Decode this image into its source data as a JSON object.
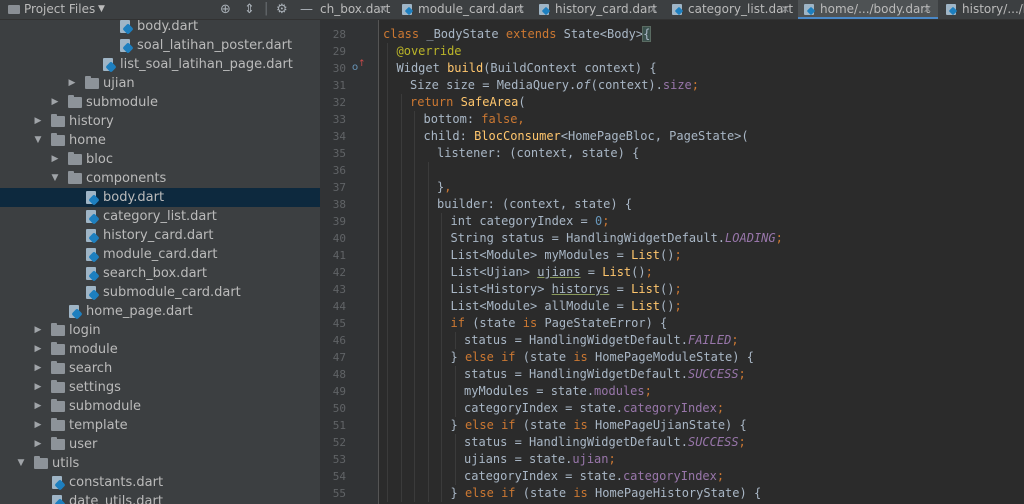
{
  "project_panel": {
    "title": "Project Files",
    "toolbar_icons": [
      "crosshair-icon",
      "collapse-icon",
      "gear-icon",
      "minimize-icon"
    ],
    "tree": [
      {
        "label": "body.dart",
        "type": "file",
        "depth": 7
      },
      {
        "label": "soal_latihan_poster.dart",
        "type": "file",
        "depth": 7
      },
      {
        "label": "list_soal_latihan_page.dart",
        "type": "file",
        "depth": 6
      },
      {
        "label": "ujian",
        "type": "folder",
        "depth": 5,
        "expanded": false
      },
      {
        "label": "submodule",
        "type": "folder",
        "depth": 4,
        "expanded": false
      },
      {
        "label": "history",
        "type": "folder",
        "depth": 3,
        "expanded": false
      },
      {
        "label": "home",
        "type": "folder",
        "depth": 3,
        "expanded": true
      },
      {
        "label": "bloc",
        "type": "folder",
        "depth": 4,
        "expanded": false
      },
      {
        "label": "components",
        "type": "folder",
        "depth": 4,
        "expanded": true
      },
      {
        "label": "body.dart",
        "type": "file",
        "depth": 5,
        "selected": true
      },
      {
        "label": "category_list.dart",
        "type": "file",
        "depth": 5
      },
      {
        "label": "history_card.dart",
        "type": "file",
        "depth": 5
      },
      {
        "label": "module_card.dart",
        "type": "file",
        "depth": 5
      },
      {
        "label": "search_box.dart",
        "type": "file",
        "depth": 5
      },
      {
        "label": "submodule_card.dart",
        "type": "file",
        "depth": 5
      },
      {
        "label": "home_page.dart",
        "type": "file",
        "depth": 4
      },
      {
        "label": "login",
        "type": "folder",
        "depth": 3,
        "expanded": false
      },
      {
        "label": "module",
        "type": "folder",
        "depth": 3,
        "expanded": false
      },
      {
        "label": "search",
        "type": "folder",
        "depth": 3,
        "expanded": false
      },
      {
        "label": "settings",
        "type": "folder",
        "depth": 3,
        "expanded": false
      },
      {
        "label": "submodule",
        "type": "folder",
        "depth": 3,
        "expanded": false
      },
      {
        "label": "template",
        "type": "folder",
        "depth": 3,
        "expanded": false
      },
      {
        "label": "user",
        "type": "folder",
        "depth": 3,
        "expanded": false
      },
      {
        "label": "utils",
        "type": "folder",
        "depth": 2,
        "expanded": true
      },
      {
        "label": "constants.dart",
        "type": "file",
        "depth": 3
      },
      {
        "label": "date_utils.dart",
        "type": "file",
        "depth": 3
      }
    ]
  },
  "tabs": [
    {
      "label": "ch_box.dart",
      "closable": true
    },
    {
      "label": "module_card.dart",
      "closable": true
    },
    {
      "label": "history_card.dart",
      "closable": true
    },
    {
      "label": "category_list.dart",
      "closable": true
    },
    {
      "label": "home/.../body.dart",
      "closable": true,
      "active": true
    },
    {
      "label": "history/.../body",
      "closable": false
    }
  ],
  "editor": {
    "line_numbers": [
      "28",
      "29",
      "30",
      "31",
      "32",
      "33",
      "34",
      "35",
      "36",
      "37",
      "38",
      "39",
      "40",
      "41",
      "42",
      "43",
      "44",
      "45",
      "46",
      "47",
      "48",
      "49",
      "50",
      "51",
      "52",
      "53",
      "54",
      "55"
    ],
    "lines": [
      {
        "indent": 0,
        "tokens": [
          [
            "kw",
            "class "
          ],
          [
            "",
            "_BodyState "
          ],
          [
            "kw",
            "extends "
          ],
          [
            "",
            "State<Body>"
          ],
          [
            "brk",
            "{"
          ]
        ]
      },
      {
        "indent": 1,
        "tokens": [
          [
            "an",
            "@override"
          ]
        ]
      },
      {
        "indent": 1,
        "tokens": [
          [
            "",
            "Widget "
          ],
          [
            "fn",
            "build"
          ],
          [
            "",
            "(BuildContext context) {"
          ]
        ]
      },
      {
        "indent": 2,
        "tokens": [
          [
            "",
            "Size size = MediaQuery."
          ],
          [
            "it",
            "of"
          ],
          [
            "",
            "(context)."
          ],
          [
            "fld",
            "size"
          ],
          [
            "kw",
            ";"
          ]
        ]
      },
      {
        "indent": 2,
        "tokens": [
          [
            "kw",
            "return "
          ],
          [
            "fn",
            "SafeArea"
          ],
          [
            "",
            "("
          ]
        ]
      },
      {
        "indent": 3,
        "tokens": [
          [
            "",
            "bottom: "
          ],
          [
            "kw",
            "false,"
          ]
        ]
      },
      {
        "indent": 3,
        "tokens": [
          [
            "",
            "child: "
          ],
          [
            "fn",
            "BlocConsumer"
          ],
          [
            "",
            "<HomePageBloc, PageState>("
          ]
        ]
      },
      {
        "indent": 4,
        "tokens": [
          [
            "",
            "listener: (context, state) {"
          ]
        ]
      },
      {
        "indent": 0,
        "tokens": []
      },
      {
        "indent": 4,
        "tokens": [
          [
            "",
            "}"
          ],
          [
            "kw",
            ","
          ]
        ]
      },
      {
        "indent": 4,
        "tokens": [
          [
            "",
            "builder: (context, state) {"
          ]
        ]
      },
      {
        "indent": 5,
        "tokens": [
          [
            "",
            "int categoryIndex = "
          ],
          [
            "num",
            "0"
          ],
          [
            "kw",
            ";"
          ]
        ]
      },
      {
        "indent": 5,
        "tokens": [
          [
            "",
            "String status = HandlingWidgetDefault."
          ],
          [
            "fit",
            "LOADING"
          ],
          [
            "kw",
            ";"
          ]
        ]
      },
      {
        "indent": 5,
        "tokens": [
          [
            "",
            "List<Module> myModules = "
          ],
          [
            "fn",
            "List"
          ],
          [
            "",
            "()"
          ],
          [
            "kw",
            ";"
          ]
        ]
      },
      {
        "indent": 5,
        "tokens": [
          [
            "",
            "List<Ujian> "
          ],
          [
            "wavy",
            "ujians"
          ],
          [
            "",
            " = "
          ],
          [
            "fn",
            "List"
          ],
          [
            "",
            "()"
          ],
          [
            "kw",
            ";"
          ]
        ]
      },
      {
        "indent": 5,
        "tokens": [
          [
            "",
            "List<History> "
          ],
          [
            "wavy",
            "historys"
          ],
          [
            "",
            " = "
          ],
          [
            "fn",
            "List"
          ],
          [
            "",
            "()"
          ],
          [
            "kw",
            ";"
          ]
        ]
      },
      {
        "indent": 5,
        "tokens": [
          [
            "",
            "List<Module> allModule = "
          ],
          [
            "fn",
            "List"
          ],
          [
            "",
            "()"
          ],
          [
            "kw",
            ";"
          ]
        ]
      },
      {
        "indent": 5,
        "tokens": [
          [
            "kw",
            "if "
          ],
          [
            "",
            "(state "
          ],
          [
            "kw",
            "is "
          ],
          [
            "",
            "PageStateError) {"
          ]
        ]
      },
      {
        "indent": 6,
        "tokens": [
          [
            "",
            "status = HandlingWidgetDefault."
          ],
          [
            "fit",
            "FAILED"
          ],
          [
            "kw",
            ";"
          ]
        ]
      },
      {
        "indent": 5,
        "tokens": [
          [
            "",
            "} "
          ],
          [
            "kw",
            "else if "
          ],
          [
            "",
            "(state "
          ],
          [
            "kw",
            "is "
          ],
          [
            "",
            "HomePageModuleState) {"
          ]
        ]
      },
      {
        "indent": 6,
        "tokens": [
          [
            "",
            "status = HandlingWidgetDefault."
          ],
          [
            "fit",
            "SUCCESS"
          ],
          [
            "kw",
            ";"
          ]
        ]
      },
      {
        "indent": 6,
        "tokens": [
          [
            "",
            "myModules = state."
          ],
          [
            "fld",
            "modules"
          ],
          [
            "kw",
            ";"
          ]
        ]
      },
      {
        "indent": 6,
        "tokens": [
          [
            "",
            "categoryIndex = state."
          ],
          [
            "fld",
            "categoryIndex"
          ],
          [
            "kw",
            ";"
          ]
        ]
      },
      {
        "indent": 5,
        "tokens": [
          [
            "",
            "} "
          ],
          [
            "kw",
            "else if "
          ],
          [
            "",
            "(state "
          ],
          [
            "kw",
            "is "
          ],
          [
            "",
            "HomePageUjianState) {"
          ]
        ]
      },
      {
        "indent": 6,
        "tokens": [
          [
            "",
            "status = HandlingWidgetDefault."
          ],
          [
            "fit",
            "SUCCESS"
          ],
          [
            "kw",
            ";"
          ]
        ]
      },
      {
        "indent": 6,
        "tokens": [
          [
            "",
            "ujians = state."
          ],
          [
            "fld",
            "ujian"
          ],
          [
            "kw",
            ";"
          ]
        ]
      },
      {
        "indent": 6,
        "tokens": [
          [
            "",
            "categoryIndex = state."
          ],
          [
            "fld",
            "categoryIndex"
          ],
          [
            "kw",
            ";"
          ]
        ]
      },
      {
        "indent": 5,
        "tokens": [
          [
            "",
            "} "
          ],
          [
            "kw",
            "else if "
          ],
          [
            "",
            "(state "
          ],
          [
            "kw",
            "is "
          ],
          [
            "",
            "HomePageHistoryState) {"
          ]
        ]
      }
    ]
  },
  "colors": {
    "panel_bg": "#3c3f41",
    "editor_bg": "#2b2b2b",
    "gutter_bg": "#313335",
    "selection": "#0d293e",
    "keyword": "#cc7832",
    "annotation": "#bbb529",
    "function": "#ffc66d",
    "field": "#9876aa",
    "number": "#6897bb",
    "active_tab_underline": "#4a88c7"
  }
}
